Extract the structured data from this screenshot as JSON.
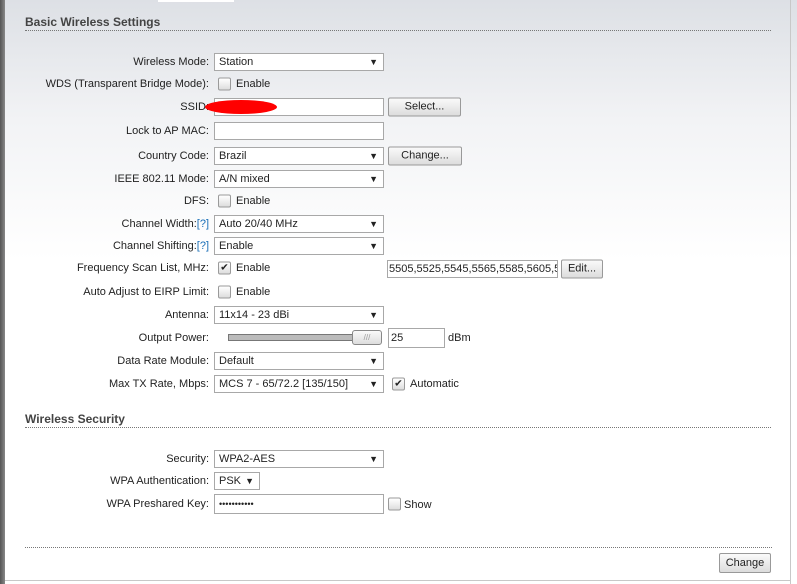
{
  "basic": {
    "title": "Basic Wireless Settings",
    "wireless_mode": {
      "label": "Wireless Mode:",
      "value": "Station"
    },
    "wds": {
      "label": "WDS (Transparent Bridge Mode):",
      "checkbox": "Enable",
      "checked": false
    },
    "ssid": {
      "label": "SSID:",
      "value": "",
      "select_button": "Select..."
    },
    "lock_ap": {
      "label": "Lock to AP MAC:",
      "value": ""
    },
    "country": {
      "label": "Country Code:",
      "value": "Brazil",
      "change_button": "Change..."
    },
    "ieee": {
      "label": "IEEE 802.11 Mode:",
      "value": "A/N mixed"
    },
    "dfs": {
      "label": "DFS:",
      "checkbox": "Enable",
      "checked": false
    },
    "channel_width": {
      "label": "Channel Width:",
      "help": "[?]",
      "value": "Auto 20/40 MHz"
    },
    "channel_shifting": {
      "label": "Channel Shifting:",
      "help": "[?]",
      "value": "Enable"
    },
    "freq_scan": {
      "label": "Frequency Scan List, MHz:",
      "checkbox": "Enable",
      "checked": true,
      "value": "5505,5525,5545,5565,5585,5605,5",
      "edit_button": "Edit..."
    },
    "eirp": {
      "label": "Auto Adjust to EIRP Limit:",
      "checkbox": "Enable",
      "checked": false
    },
    "antenna": {
      "label": "Antenna:",
      "value": "11x14 - 23 dBi"
    },
    "output_power": {
      "label": "Output Power:",
      "value": "25",
      "unit": "dBm",
      "slider_fraction": 1.0
    },
    "data_rate": {
      "label": "Data Rate Module:",
      "value": "Default"
    },
    "max_tx": {
      "label": "Max TX Rate, Mbps:",
      "value": "MCS 7 - 65/72.2 [135/150]",
      "checkbox": "Automatic",
      "checked": true
    }
  },
  "security": {
    "title": "Wireless Security",
    "security": {
      "label": "Security:",
      "value": "WPA2-AES"
    },
    "wpa_auth": {
      "label": "WPA Authentication:",
      "value": "PSK"
    },
    "psk": {
      "label": "WPA Preshared Key:",
      "value": "•••••••••••",
      "checkbox": "Show",
      "checked": false
    }
  },
  "footer": {
    "change_button": "Change"
  }
}
